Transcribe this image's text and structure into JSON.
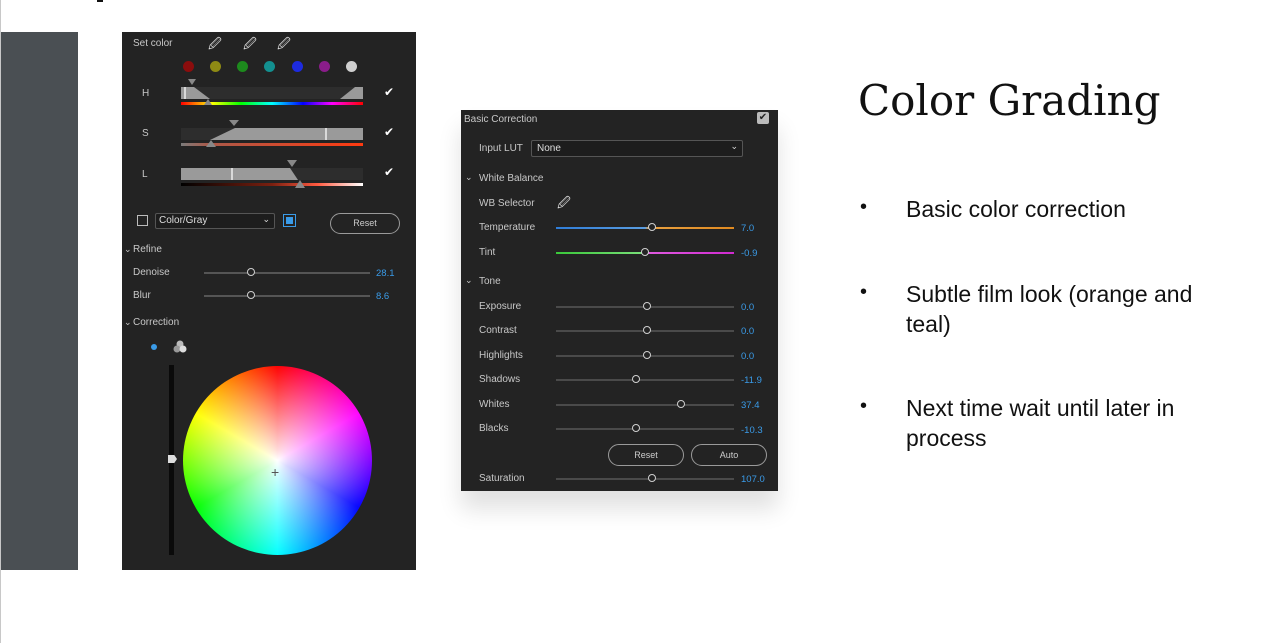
{
  "slide": {
    "title": "Color Grading",
    "bullets": [
      "Basic color correction",
      "Subtle film look (orange and teal)",
      "Next time wait until later in process"
    ]
  },
  "hsl_panel": {
    "set_color_label": "Set color",
    "swatches": [
      "#8b0d0d",
      "#8e8a14",
      "#1d8a1d",
      "#139090",
      "#1d2be0",
      "#8a1d8a",
      "#cfcfcf"
    ],
    "rows": [
      {
        "label": "H",
        "checked": true
      },
      {
        "label": "S",
        "checked": true
      },
      {
        "label": "L",
        "checked": true
      }
    ],
    "color_gray_label": "Color/Gray",
    "reset_label": "Reset",
    "refine_label": "Refine",
    "refine_sliders": [
      {
        "label": "Denoise",
        "value": "28.1",
        "fraction": 0.28
      },
      {
        "label": "Blur",
        "value": "8.6",
        "fraction": 0.28
      }
    ],
    "correction_label": "Correction"
  },
  "basic_correction": {
    "title": "Basic Correction",
    "input_lut_label": "Input LUT",
    "input_lut_value": "None",
    "white_balance_label": "White Balance",
    "wb_selector_label": "WB Selector",
    "wb_sliders": [
      {
        "label": "Temperature",
        "value": "7.0",
        "fraction": 0.54
      },
      {
        "label": "Tint",
        "value": "-0.9",
        "fraction": 0.5
      }
    ],
    "tone_label": "Tone",
    "tone_sliders": [
      {
        "label": "Exposure",
        "value": "0.0",
        "fraction": 0.51
      },
      {
        "label": "Contrast",
        "value": "0.0",
        "fraction": 0.51
      },
      {
        "label": "Highlights",
        "value": "0.0",
        "fraction": 0.51
      },
      {
        "label": "Shadows",
        "value": "-11.9",
        "fraction": 0.45
      },
      {
        "label": "Whites",
        "value": "37.4",
        "fraction": 0.7
      },
      {
        "label": "Blacks",
        "value": "-10.3",
        "fraction": 0.45
      }
    ],
    "reset_label": "Reset",
    "auto_label": "Auto",
    "saturation_label": "Saturation",
    "saturation_value": "107.0",
    "saturation_fraction": 0.54
  }
}
